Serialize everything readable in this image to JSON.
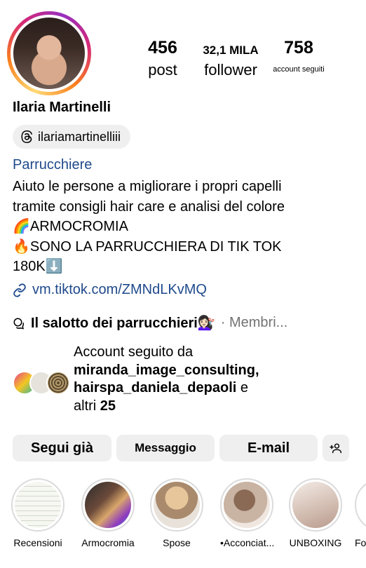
{
  "profile": {
    "name": "Ilaria Martinelli",
    "threads_handle": "ilariamartinelliii",
    "category": "Parrucchiere",
    "bio": "Aiuto le persone a migliorare i propri capelli\ntramite consigli hair care e analisi del colore\n🌈ARMOCROMIA\n🔥SONO LA PARRUCCHIERA DI TIK TOK\n180K⬇️",
    "link": "vm.tiktok.com/ZMNdLKvMQ"
  },
  "stats": {
    "posts_value": "456",
    "posts_label": "post",
    "followers_value": "32,1 MILA",
    "followers_label": "follower",
    "following_value": "758",
    "following_label": "account seguiti"
  },
  "community": {
    "name": "Il salotto dei parrucchieri💇🏻‍♀️",
    "meta": "· Membri..."
  },
  "followed_by": {
    "intro": "Account seguito da",
    "user1": "miranda_image_consulting,",
    "user2": "hairspa_daniela_depaoli",
    "and": "e",
    "others_prefix": "altri",
    "others_count": "25"
  },
  "actions": {
    "follow_label": "Segui già",
    "message_label": "Messaggio",
    "email_label": "E-mail"
  },
  "highlights": [
    {
      "label": "Recensioni"
    },
    {
      "label": "Armocromia"
    },
    {
      "label": "Spose"
    },
    {
      "label": "•Acconciat..."
    },
    {
      "label": "UNBOXING"
    },
    {
      "label": "Fo"
    }
  ],
  "colors": {
    "link_blue": "#1f4a8c",
    "button_grey": "#efefef",
    "meta_grey": "#737373"
  }
}
